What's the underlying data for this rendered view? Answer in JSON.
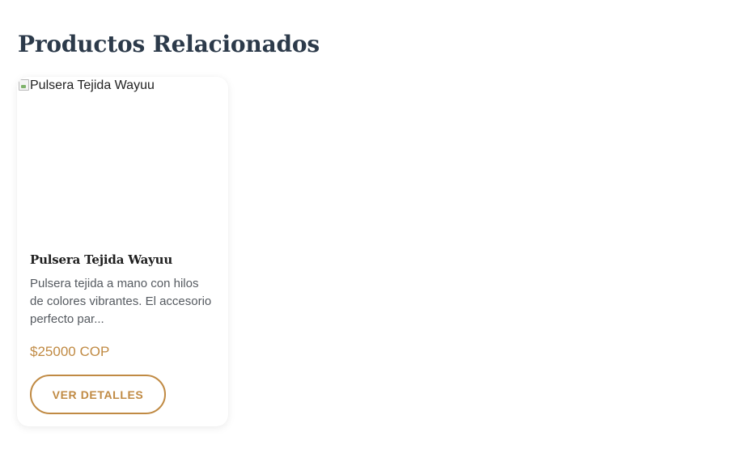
{
  "section": {
    "title": "Productos Relacionados"
  },
  "products": [
    {
      "image_alt": "Pulsera Tejida Wayuu",
      "name": "Pulsera Tejida Wayuu",
      "description": "Pulsera tejida a mano con hilos de colores vibrantes. El accesorio perfecto par...",
      "price": "$25000 COP",
      "button_label": "VER DETALLES"
    }
  ],
  "colors": {
    "heading": "#2c3a4a",
    "accent": "#c08a43",
    "body_text": "#555a60"
  },
  "icons": {
    "broken_image": "broken-image-icon"
  }
}
